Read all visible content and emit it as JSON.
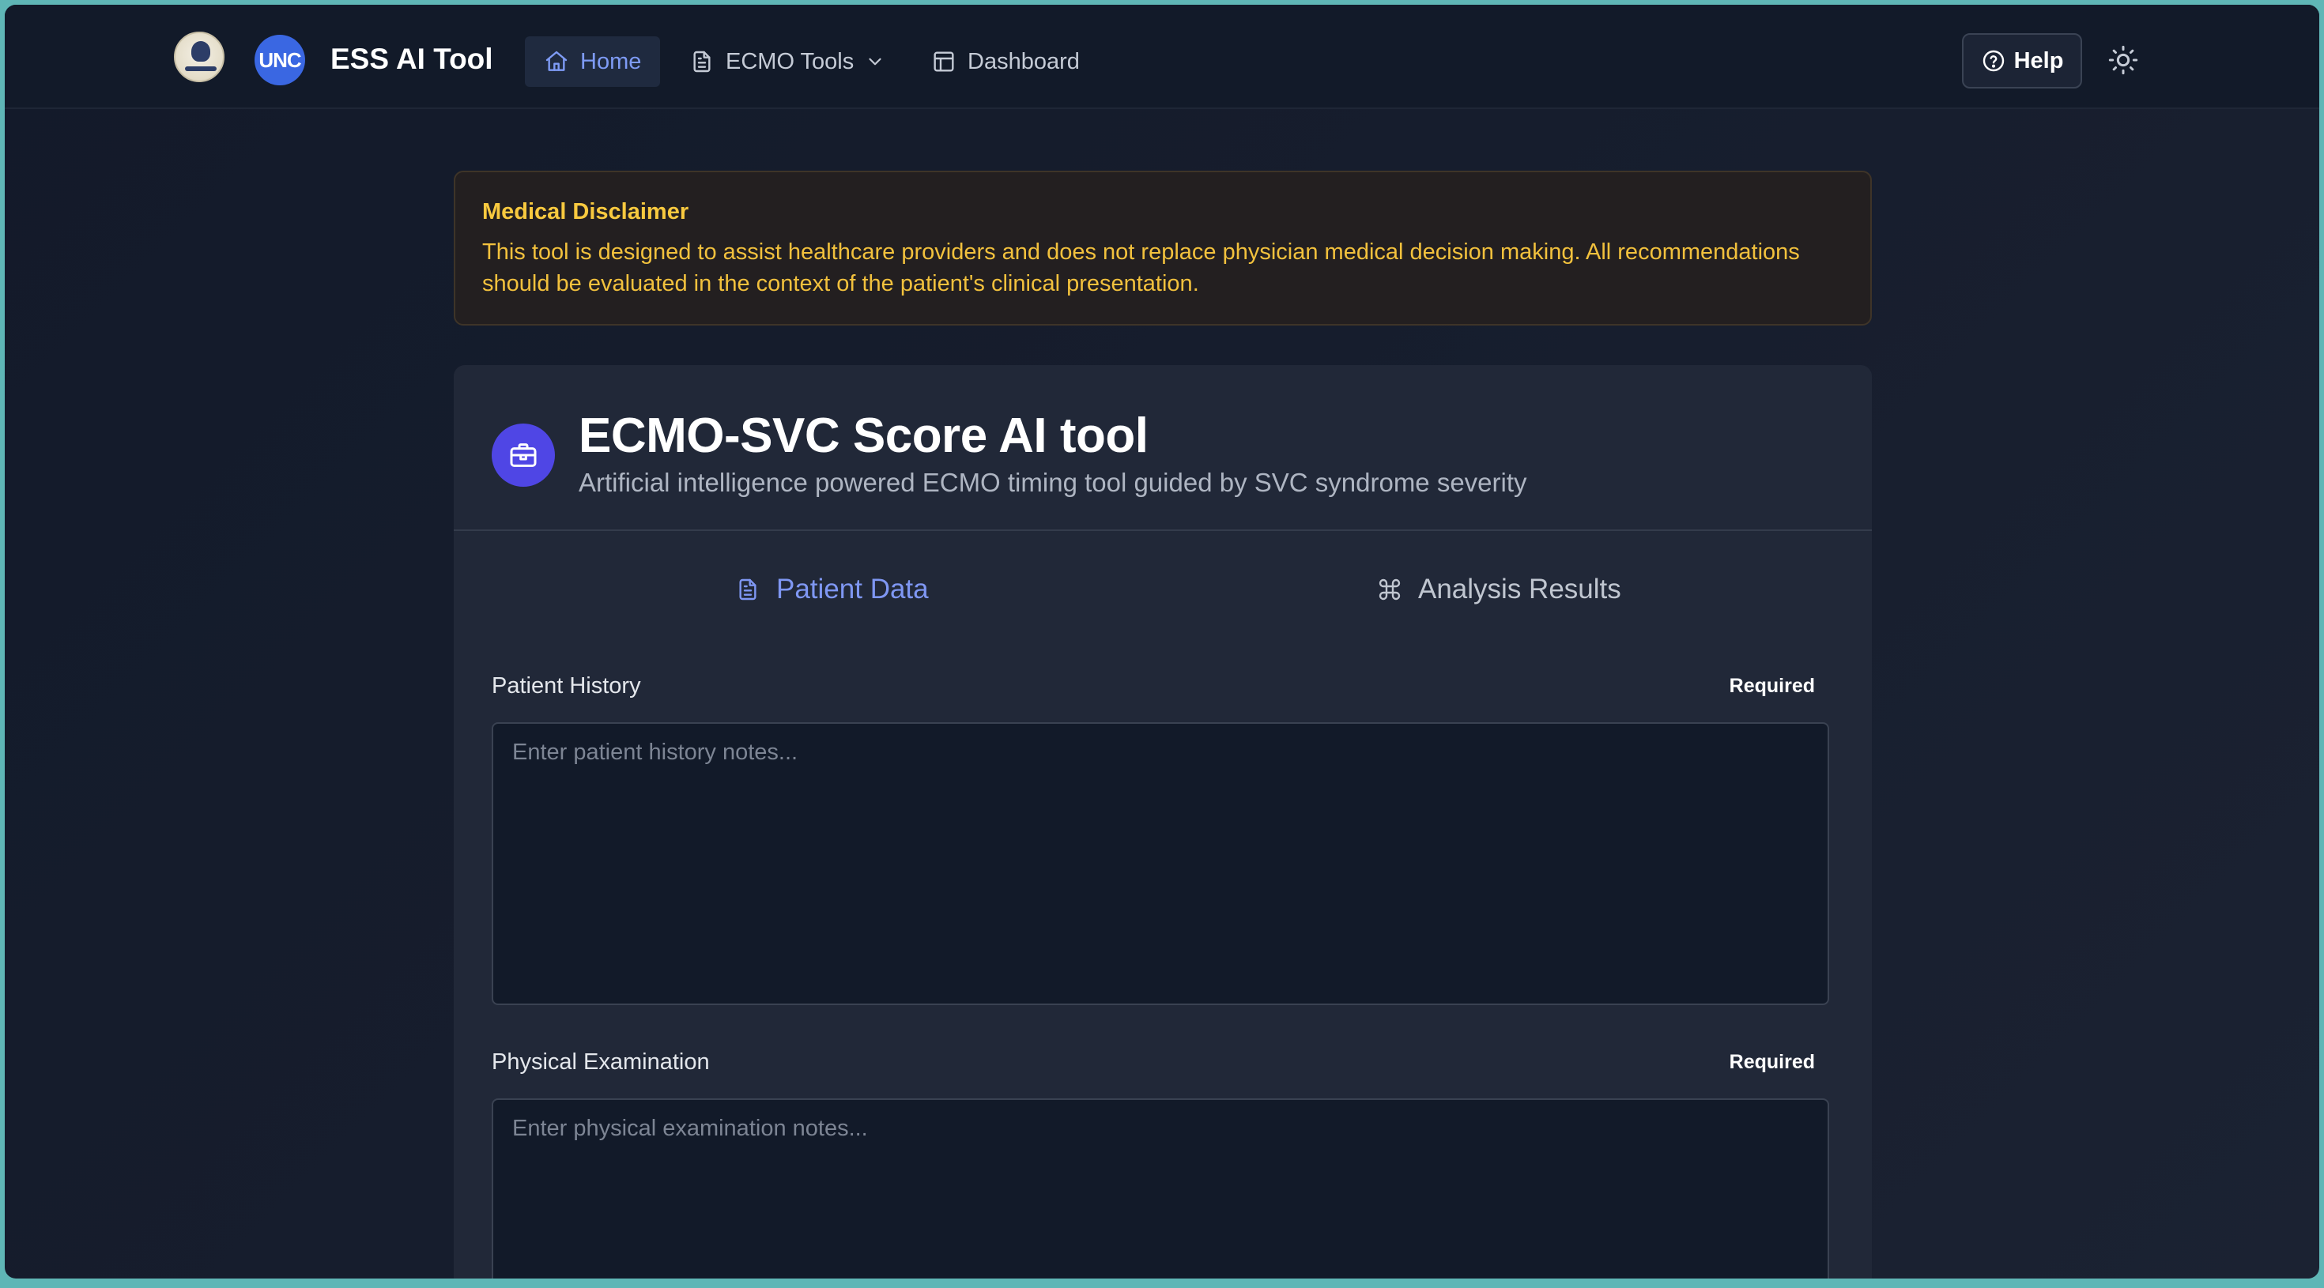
{
  "header": {
    "brand": "ESS AI Tool",
    "unc_logo_text": "UNC",
    "nav": [
      {
        "label": "Home",
        "icon": "home-icon",
        "active": true
      },
      {
        "label": "ECMO Tools",
        "icon": "document-icon",
        "dropdown": true
      },
      {
        "label": "Dashboard",
        "icon": "layout-icon"
      }
    ],
    "help_label": "Help"
  },
  "disclaimer": {
    "title": "Medical Disclaimer",
    "text": "This tool is designed to assist healthcare providers and does not replace physician medical decision making. All recommendations should be evaluated in the context of the patient's clinical presentation."
  },
  "card": {
    "title": "ECMO-SVC Score AI tool",
    "subtitle": "Artificial intelligence powered ECMO timing tool guided by SVC syndrome severity",
    "tabs": [
      {
        "label": "Patient Data",
        "icon": "document-icon",
        "active": true
      },
      {
        "label": "Analysis Results",
        "icon": "command-icon",
        "active": false
      }
    ],
    "fields": [
      {
        "label": "Patient History",
        "required": "Required",
        "placeholder": "Enter patient history notes...",
        "value": ""
      },
      {
        "label": "Physical Examination",
        "required": "Required",
        "placeholder": "Enter physical examination notes...",
        "value": ""
      }
    ]
  },
  "colors": {
    "accent": "#7f97f3",
    "warning": "#f2c13d",
    "tool_icon_bg": "#4f46e5",
    "unc_blue": "#3a67e2"
  }
}
